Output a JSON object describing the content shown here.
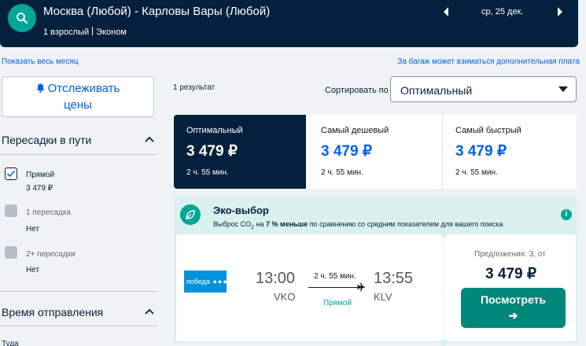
{
  "header": {
    "route": "Москва (Любой) - Карловы Вары (Любой)",
    "passengers": "1 взрослый",
    "cabin": "Эконом",
    "date": "ср, 25 дек."
  },
  "links": {
    "show_month": "Показать весь месяц",
    "baggage_note": "За багаж может взиматься дополнительная плата"
  },
  "sidebar": {
    "track_button_line1": "Отслеживать",
    "track_button_line2": "цены",
    "stops_title": "Пересадки в пути",
    "stops": [
      {
        "label": "Прямой",
        "price": "3 479 ₽",
        "checked": true
      },
      {
        "label": "1 пересадка",
        "price": "Нет",
        "checked": false
      },
      {
        "label": "2+ пересадки",
        "price": "Нет",
        "checked": false
      }
    ],
    "departure_title": "Время отправления",
    "departure_cut": "Туда"
  },
  "results": {
    "count": "1 результат",
    "sort_label": "Сортировать по",
    "sort_value": "Оптимальный"
  },
  "tabs": [
    {
      "name": "Оптимальный",
      "price": "3 479 ₽",
      "duration": "2 ч. 55 мин."
    },
    {
      "name": "Самый дешевый",
      "price": "3 479 ₽",
      "duration": "2 ч. 55 мин."
    },
    {
      "name": "Самый быстрый",
      "price": "3 479 ₽",
      "duration": "2 ч. 55 мин."
    }
  ],
  "eco": {
    "title": "Эко-выбор",
    "text_before": "Выброс CO",
    "text_sub": "2",
    "text_mid": " на ",
    "text_bold": "7 % меньше",
    "text_after": " по сравнению со средним показателем для вашего поиска"
  },
  "flight": {
    "airline": "победа",
    "depart_time": "13:00",
    "depart_code": "VKO",
    "duration": "2 ч. 55 мин.",
    "stops": "Прямой",
    "arrive_time": "13:55",
    "arrive_code": "KLV",
    "offers": "Предложения: 3, от",
    "price": "3 479 ₽",
    "button": "Посмотреть",
    "button_arrow": "➔"
  },
  "colors": {
    "navy": "#05203c",
    "teal": "#00a698",
    "button_teal": "#00877a",
    "link_blue": "#0062e3",
    "eco_bg": "#d9f0ec"
  }
}
